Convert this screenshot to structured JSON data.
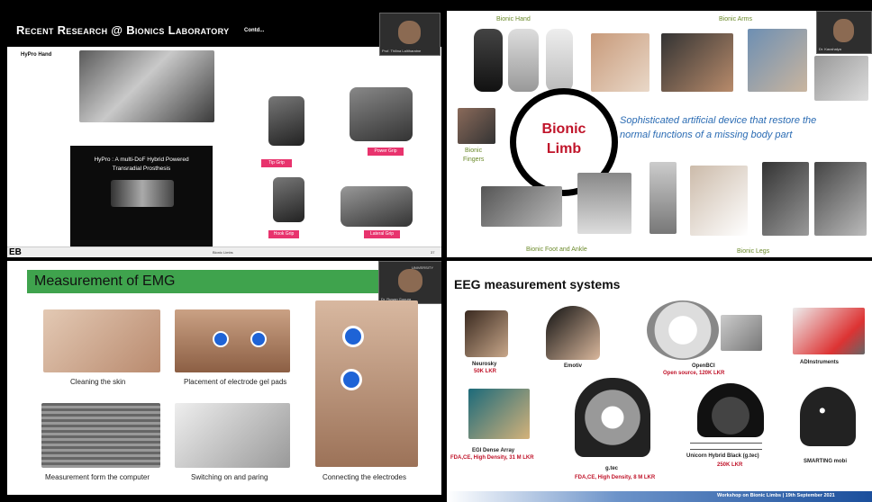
{
  "q1": {
    "title": "Recent Research @ Bionics Laboratory",
    "title_suffix": "Contd...",
    "subtitle": "HyPro Hand",
    "video_title_1": "HyPro : A multi-DoF Hybrid Powered",
    "video_title_2": "Transradial Prosthesis",
    "grips": [
      "Tip Grip",
      "Power Grip",
      "Hook Grip",
      "Lateral Grip"
    ],
    "footer_logo": "EB",
    "footer_center": "Bionic Limbs",
    "page_number": "37",
    "presenter_name": "Prof. Thilina Lalitharatne"
  },
  "q2": {
    "labels": {
      "hand": "Bionic Hand",
      "arms": "Bionic Arms",
      "fingers_1": "Bionic",
      "fingers_2": "Fingers",
      "foot": "Bionic Foot and Ankle",
      "legs": "Bionic Legs"
    },
    "circle_line1": "Bionic",
    "circle_line2": "Limb",
    "definition_1": "Sophisticated artificial device that restore the",
    "definition_2": "normal functions of a missing body part",
    "presenter_name": "Dr. Kaushalya"
  },
  "q3": {
    "title": "Measurement of EMG",
    "captions": [
      "Cleaning the skin",
      "Placement of electrode gel pads",
      "Connecting the electrodes",
      "Measurement form the computer",
      "Switching on and paring"
    ],
    "university_label": "UNIVERSITY",
    "presenter_name": "Dr. Ruwan Gopura"
  },
  "q4": {
    "title": "EEG measurement systems",
    "items": [
      {
        "name": "Neurosky",
        "sub": "50K LKR"
      },
      {
        "name": "Emotiv",
        "sub": ""
      },
      {
        "name": "OpenBCI",
        "sub": "Open source, 120K LKR"
      },
      {
        "name": "ADInstruments",
        "sub": ""
      },
      {
        "name": "EGI Dense Array",
        "sub": "FDA,CE, High Density, 31 M LKR"
      },
      {
        "name": "g.tec",
        "sub": "FDA,CE, High Density, 8 M LKR"
      },
      {
        "name": "Unicorn Hybrid Black (g.tec)",
        "sub": "250K LKR"
      },
      {
        "name": "SMARTING mobi",
        "sub": ""
      }
    ],
    "footer": "Workshop on Bionic Limbs | 19th September 2021"
  },
  "colors": {
    "emg_green": "#3fa34d",
    "accent_red": "#c0142a",
    "pink": "#e8336d",
    "footer_blue": "#1b4f9c",
    "blue_italic": "#2a6bb3"
  }
}
